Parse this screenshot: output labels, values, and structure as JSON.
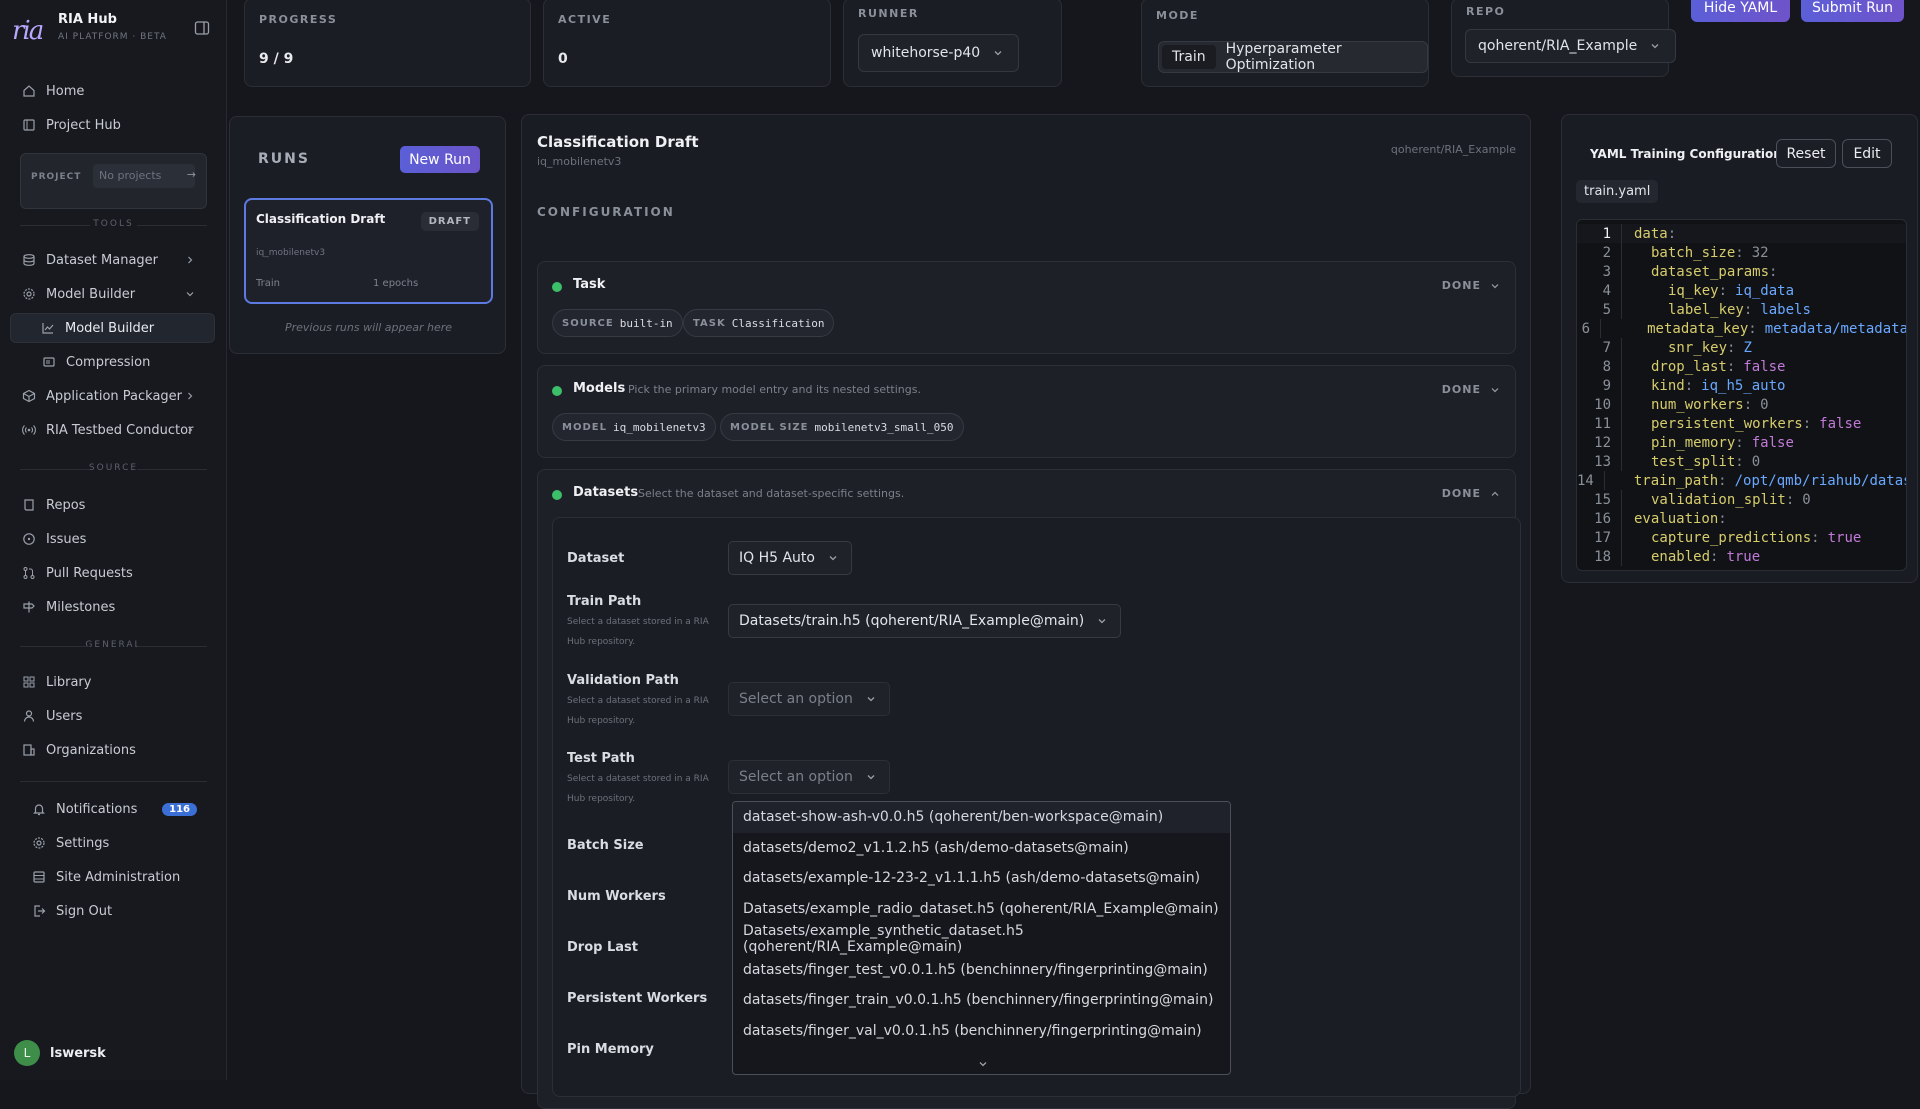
{
  "app": {
    "name": "RIA Hub",
    "subtitle": "AI PLATFORM · BETA",
    "logo": "ria"
  },
  "sidebar": {
    "top_items": [
      {
        "label": "Home",
        "icon": "home-icon"
      },
      {
        "label": "Project Hub",
        "icon": "project-icon"
      }
    ],
    "project": {
      "label": "PROJECT",
      "placeholder": "No projects",
      "arrow": "→"
    },
    "tools_label": "TOOLS",
    "tools": [
      {
        "label": "Dataset Manager",
        "icon": "database-icon"
      },
      {
        "label": "Model Builder",
        "icon": "gear-icon"
      },
      {
        "label": "Model Builder",
        "icon": "chart-icon"
      },
      {
        "label": "Compression",
        "icon": "compress-icon"
      },
      {
        "label": "Application Packager",
        "icon": "package-icon"
      },
      {
        "label": "RIA Testbed Conductor",
        "icon": "signal-icon"
      }
    ],
    "source_label": "SOURCE",
    "source": [
      {
        "label": "Repos",
        "icon": "repo-icon"
      },
      {
        "label": "Issues",
        "icon": "issue-icon"
      },
      {
        "label": "Pull Requests",
        "icon": "pull-request-icon"
      },
      {
        "label": "Milestones",
        "icon": "milestone-icon"
      }
    ],
    "general_label": "GENERAL",
    "general": [
      {
        "label": "Library",
        "icon": "library-icon"
      },
      {
        "label": "Users",
        "icon": "user-icon"
      },
      {
        "label": "Organizations",
        "icon": "organization-icon"
      }
    ],
    "bottom": [
      {
        "label": "Notifications",
        "icon": "bell-icon",
        "badge": "116"
      },
      {
        "label": "Settings",
        "icon": "settings-icon"
      },
      {
        "label": "Site Administration",
        "icon": "admin-icon"
      },
      {
        "label": "Sign Out",
        "icon": "sign-out-icon"
      }
    ],
    "user": {
      "initial": "L",
      "name": "lswersk"
    }
  },
  "top": {
    "progress": {
      "label": "PROGRESS",
      "value": "9 / 9"
    },
    "active": {
      "label": "ACTIVE",
      "value": "0"
    },
    "runner": {
      "label": "RUNNER",
      "value": "whitehorse-p40"
    },
    "mode": {
      "label": "MODE",
      "options": [
        "Train",
        "Hyperparameter Optimization"
      ]
    },
    "repo": {
      "label": "REPO",
      "value": "qoherent/RIA_Example"
    },
    "hide_yaml": "Hide YAML",
    "submit_run": "Submit Run"
  },
  "runs": {
    "title": "RUNS",
    "new_run": "New Run",
    "card": {
      "name": "Classification Draft",
      "status": "DRAFT",
      "model": "iq_mobilenetv3",
      "mode": "Train",
      "epochs": "1 epochs"
    },
    "hint": "Previous runs will appear here"
  },
  "config": {
    "title": "Classification Draft",
    "model": "iq_mobilenetv3",
    "repo": "qoherent/RIA_Example",
    "section": "CONFIGURATION",
    "task": {
      "title": "Task",
      "status": "DONE",
      "chips": [
        {
          "k": "SOURCE",
          "v": "built-in"
        },
        {
          "k": "TASK",
          "v": "Classification"
        }
      ]
    },
    "models": {
      "title": "Models",
      "desc": "Pick the primary model entry and its nested settings.",
      "status": "DONE",
      "chips": [
        {
          "k": "MODEL",
          "v": "iq_mobilenetv3"
        },
        {
          "k": "MODEL SIZE",
          "v": "mobilenetv3_small_050"
        }
      ]
    },
    "datasets": {
      "title": "Datasets",
      "desc": "Select the dataset and dataset-specific settings.",
      "status": "DONE",
      "dataset": {
        "label": "Dataset",
        "value": "IQ H5 Auto"
      },
      "train_path": {
        "label": "Train Path",
        "help": "Select a dataset stored in a RIA Hub repository.",
        "value": "Datasets/train.h5 (qoherent/RIA_Example@main)"
      },
      "validation_path": {
        "label": "Validation Path",
        "help": "Select a dataset stored in a RIA Hub repository.",
        "placeholder": "Select an option"
      },
      "test_path": {
        "label": "Test Path",
        "help": "Select a dataset stored in a RIA Hub repository.",
        "placeholder": "Select an option"
      },
      "batch_size": {
        "label": "Batch Size"
      },
      "num_workers": {
        "label": "Num Workers"
      },
      "drop_last": {
        "label": "Drop Last"
      },
      "persistent_workers": {
        "label": "Persistent Workers"
      },
      "pin_memory": {
        "label": "Pin Memory"
      },
      "options": [
        "dataset-show-ash-v0.0.h5 (qoherent/ben-workspace@main)",
        "datasets/demo2_v1.1.2.h5 (ash/demo-datasets@main)",
        "datasets/example-12-23-2_v1.1.1.h5 (ash/demo-datasets@main)",
        "Datasets/example_radio_dataset.h5 (qoherent/RIA_Example@main)",
        "Datasets/example_synthetic_dataset.h5 (qoherent/RIA_Example@main)",
        "datasets/finger_test_v0.0.1.h5 (benchinnery/fingerprinting@main)",
        "datasets/finger_train_v0.0.1.h5 (benchinnery/fingerprinting@main)",
        "datasets/finger_val_v0.0.1.h5 (benchinnery/fingerprinting@main)"
      ]
    }
  },
  "yaml": {
    "title": "YAML Training Configuration",
    "reset": "Reset",
    "edit": "Edit",
    "file": "train.yaml",
    "lines": [
      {
        "n": "1",
        "indent": 0,
        "k": "data",
        "v": "",
        "t": ""
      },
      {
        "n": "2",
        "indent": 1,
        "k": "batch_size",
        "v": "32",
        "t": "num"
      },
      {
        "n": "3",
        "indent": 1,
        "k": "dataset_params",
        "v": "",
        "t": ""
      },
      {
        "n": "4",
        "indent": 2,
        "k": "iq_key",
        "v": "iq_data",
        "t": "str"
      },
      {
        "n": "5",
        "indent": 2,
        "k": "label_key",
        "v": "labels",
        "t": "str"
      },
      {
        "n": "6",
        "indent": 2,
        "k": "metadata_key",
        "v": "metadata/metadata",
        "t": "str"
      },
      {
        "n": "7",
        "indent": 2,
        "k": "snr_key",
        "v": "Z",
        "t": "str"
      },
      {
        "n": "8",
        "indent": 1,
        "k": "drop_last",
        "v": "false",
        "t": "bool"
      },
      {
        "n": "9",
        "indent": 1,
        "k": "kind",
        "v": "iq_h5_auto",
        "t": "str"
      },
      {
        "n": "10",
        "indent": 1,
        "k": "num_workers",
        "v": "0",
        "t": "num"
      },
      {
        "n": "11",
        "indent": 1,
        "k": "persistent_workers",
        "v": "false",
        "t": "bool"
      },
      {
        "n": "12",
        "indent": 1,
        "k": "pin_memory",
        "v": "false",
        "t": "bool"
      },
      {
        "n": "13",
        "indent": 1,
        "k": "test_split",
        "v": "0",
        "t": "num"
      },
      {
        "n": "14",
        "indent": 1,
        "k": "train_path",
        "v": "/opt/qmb/riahub/datasets",
        "t": "str"
      },
      {
        "n": "15",
        "indent": 1,
        "k": "validation_split",
        "v": "0",
        "t": "num"
      },
      {
        "n": "16",
        "indent": 0,
        "k": "evaluation",
        "v": "",
        "t": ""
      },
      {
        "n": "17",
        "indent": 1,
        "k": "capture_predictions",
        "v": "true",
        "t": "bool"
      },
      {
        "n": "18",
        "indent": 1,
        "k": "enabled",
        "v": "true",
        "t": "bool"
      }
    ]
  },
  "colors": {
    "accent": "#5b5fd8",
    "done_dot": "#3dbf6a",
    "badge": "#3c6fd6"
  }
}
